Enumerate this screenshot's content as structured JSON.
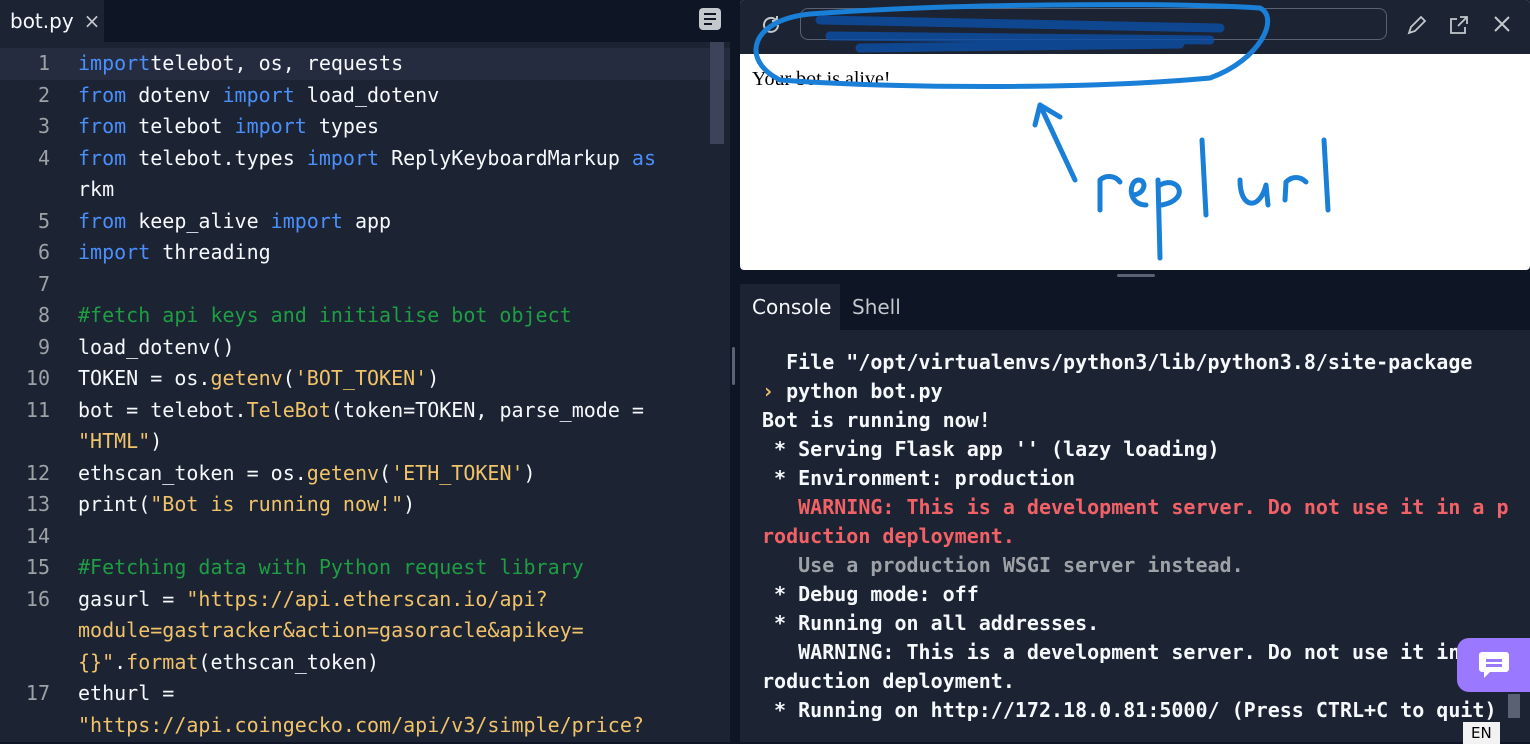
{
  "editor": {
    "tab": {
      "name": "bot.py",
      "close_glyph": "×"
    },
    "menu_icon": "hamburger-icon",
    "lines": [
      {
        "n": "1",
        "active": true,
        "tokens": [
          [
            "kw",
            "import"
          ],
          [
            "",
            "telebot, os, requests"
          ]
        ]
      },
      {
        "n": "2",
        "tokens": [
          [
            "kw",
            "from"
          ],
          [
            "",
            " dotenv "
          ],
          [
            "kw",
            "import"
          ],
          [
            "",
            " load_dotenv"
          ]
        ]
      },
      {
        "n": "3",
        "tokens": [
          [
            "kw",
            "from"
          ],
          [
            "",
            " telebot "
          ],
          [
            "kw",
            "import"
          ],
          [
            "",
            " types"
          ]
        ]
      },
      {
        "n": "4",
        "tokens": [
          [
            "kw",
            "from"
          ],
          [
            "",
            " telebot.types "
          ],
          [
            "kw",
            "import"
          ],
          [
            "",
            " ReplyKeyboardMarkup "
          ],
          [
            "kw",
            "as"
          ]
        ]
      },
      {
        "n": "",
        "tokens": [
          [
            "",
            "rkm"
          ]
        ]
      },
      {
        "n": "5",
        "tokens": [
          [
            "kw",
            "from"
          ],
          [
            "",
            " keep_alive "
          ],
          [
            "kw",
            "import"
          ],
          [
            "",
            " app"
          ]
        ]
      },
      {
        "n": "6",
        "tokens": [
          [
            "kw",
            "import"
          ],
          [
            "",
            " threading"
          ]
        ]
      },
      {
        "n": "7",
        "tokens": []
      },
      {
        "n": "8",
        "tokens": [
          [
            "cm",
            "#fetch api keys and initialise bot object"
          ]
        ]
      },
      {
        "n": "9",
        "tokens": [
          [
            "",
            "load_dotenv()"
          ]
        ]
      },
      {
        "n": "10",
        "tokens": [
          [
            "",
            "TOKEN = os."
          ],
          [
            "fn",
            "getenv"
          ],
          [
            "",
            "("
          ],
          [
            "st",
            "'BOT_TOKEN'"
          ],
          [
            "",
            ")"
          ]
        ]
      },
      {
        "n": "11",
        "tokens": [
          [
            "",
            "bot = telebot."
          ],
          [
            "fn",
            "TeleBot"
          ],
          [
            "",
            "(token=TOKEN, parse_mode ="
          ]
        ]
      },
      {
        "n": "",
        "tokens": [
          [
            "st",
            "\"HTML\""
          ],
          [
            "",
            ")"
          ]
        ]
      },
      {
        "n": "12",
        "tokens": [
          [
            "",
            "ethscan_token = os."
          ],
          [
            "fn",
            "getenv"
          ],
          [
            "",
            "("
          ],
          [
            "st",
            "'ETH_TOKEN'"
          ],
          [
            "",
            ")"
          ]
        ]
      },
      {
        "n": "13",
        "tokens": [
          [
            "",
            "print("
          ],
          [
            "st",
            "\"Bot is running now!\""
          ],
          [
            "",
            ")"
          ]
        ]
      },
      {
        "n": "14",
        "tokens": []
      },
      {
        "n": "15",
        "tokens": [
          [
            "cm",
            "#Fetching data with Python request library"
          ]
        ]
      },
      {
        "n": "16",
        "tokens": [
          [
            "",
            "gasurl = "
          ],
          [
            "st",
            "\"https://api.etherscan.io/api?"
          ]
        ]
      },
      {
        "n": "",
        "tokens": [
          [
            "st",
            "module=gastracker&action=gasoracle&apikey="
          ]
        ]
      },
      {
        "n": "",
        "tokens": [
          [
            "st",
            "{}\""
          ],
          [
            "",
            "."
          ],
          [
            "fn",
            "format"
          ],
          [
            "",
            "(ethscan_token)"
          ]
        ]
      },
      {
        "n": "17",
        "tokens": [
          [
            "",
            "ethurl ="
          ]
        ]
      },
      {
        "n": "",
        "tokens": [
          [
            "st",
            "\"https://api.coingecko.com/api/v3/simple/price?"
          ]
        ]
      }
    ]
  },
  "preview": {
    "body_text": "Your bot is alive!",
    "annotation": "repl url",
    "icons": [
      "refresh-icon",
      "pencil-icon",
      "open-external-icon",
      "close-icon"
    ]
  },
  "console": {
    "tabs": [
      "Console",
      "Shell"
    ],
    "lines": [
      {
        "cls": "",
        "text": "  File \"/opt/virtualenvs/python3/lib/python3.8/site-package"
      },
      {
        "cls": "prompt",
        "prompt": "› ",
        "text": "python bot.py"
      },
      {
        "cls": "",
        "text": "Bot is running now!"
      },
      {
        "cls": "",
        "text": " * Serving Flask app '' (lazy loading)"
      },
      {
        "cls": "",
        "text": " * Environment: production"
      },
      {
        "cls": "warn",
        "text": "   WARNING: This is a development server. Do not use it in a p"
      },
      {
        "cls": "warn",
        "text": "roduction deployment."
      },
      {
        "cls": "dim",
        "text": "   Use a production WSGI server instead."
      },
      {
        "cls": "",
        "text": " * Debug mode: off"
      },
      {
        "cls": "",
        "text": " * Running on all addresses."
      },
      {
        "cls": "",
        "text": "   WARNING: This is a development server. Do not use it in"
      },
      {
        "cls": "",
        "text": "roduction deployment."
      },
      {
        "cls": "",
        "text": " * Running on http://172.18.0.81:5000/ (Press CTRL+C to quit)"
      }
    ]
  },
  "system": {
    "language": "EN",
    "chat_icon": "chat-icon"
  }
}
